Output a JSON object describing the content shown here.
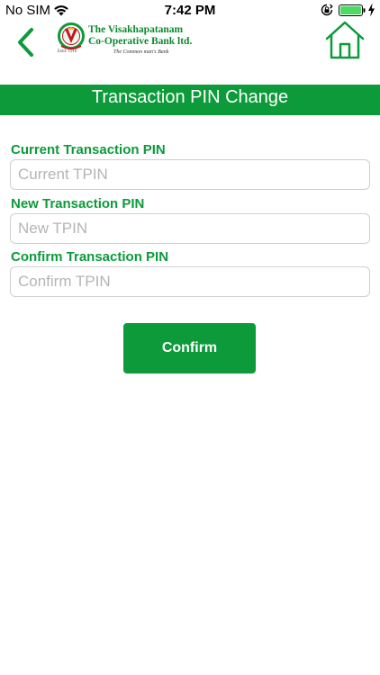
{
  "status_bar": {
    "carrier": "No SIM",
    "time": "7:42 PM"
  },
  "header": {
    "logo_line1": "The Visakhapatanam",
    "logo_line2": "Co-Operative Bank ltd.",
    "logo_estd": "Estd: 1916",
    "logo_tagline": "The Common man's Bank"
  },
  "title": "Transaction PIN Change",
  "form": {
    "current": {
      "label": "Current Transaction PIN",
      "placeholder": "Current TPIN",
      "value": ""
    },
    "new": {
      "label": "New Transaction PIN",
      "placeholder": "New TPIN",
      "value": ""
    },
    "confirm": {
      "label": "Confirm Transaction PIN",
      "placeholder": "Confirm TPIN",
      "value": ""
    },
    "confirm_button": "Confirm"
  },
  "colors": {
    "brand_green": "#0c9a3a",
    "battery_green": "#4cd964"
  },
  "icons": [
    "wifi-icon",
    "orientation-lock-icon",
    "battery-icon",
    "charging-bolt-icon",
    "back-chevron-icon",
    "home-icon"
  ]
}
